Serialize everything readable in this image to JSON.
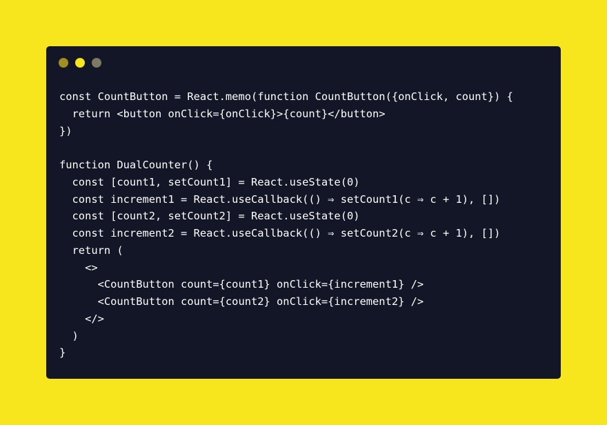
{
  "colors": {
    "background": "#f7e51e",
    "window": "#121627",
    "text": "#ffffff",
    "dot_1": "#a08f1f",
    "dot_2": "#f7e51e",
    "dot_3": "#7d7a64"
  },
  "window": {
    "controls": [
      {
        "name": "window-dot-dark-yellow-icon",
        "color": "#a08f1f"
      },
      {
        "name": "window-dot-yellow-icon",
        "color": "#f7e51e"
      },
      {
        "name": "window-dot-gray-icon",
        "color": "#7d7a64"
      }
    ]
  },
  "code": {
    "lines": [
      "const CountButton = React.memo(function CountButton({onClick, count}) {",
      "  return <button onClick={onClick}>{count}</button>",
      "})",
      "",
      "function DualCounter() {",
      "  const [count1, setCount1] = React.useState(0)",
      "  const increment1 = React.useCallback(() ⇒ setCount1(c ⇒ c + 1), [])",
      "  const [count2, setCount2] = React.useState(0)",
      "  const increment2 = React.useCallback(() ⇒ setCount2(c ⇒ c + 1), [])",
      "  return (",
      "    <>",
      "      <CountButton count={count1} onClick={increment1} />",
      "      <CountButton count={count2} onClick={increment2} />",
      "    </>",
      "  )",
      "}"
    ]
  }
}
